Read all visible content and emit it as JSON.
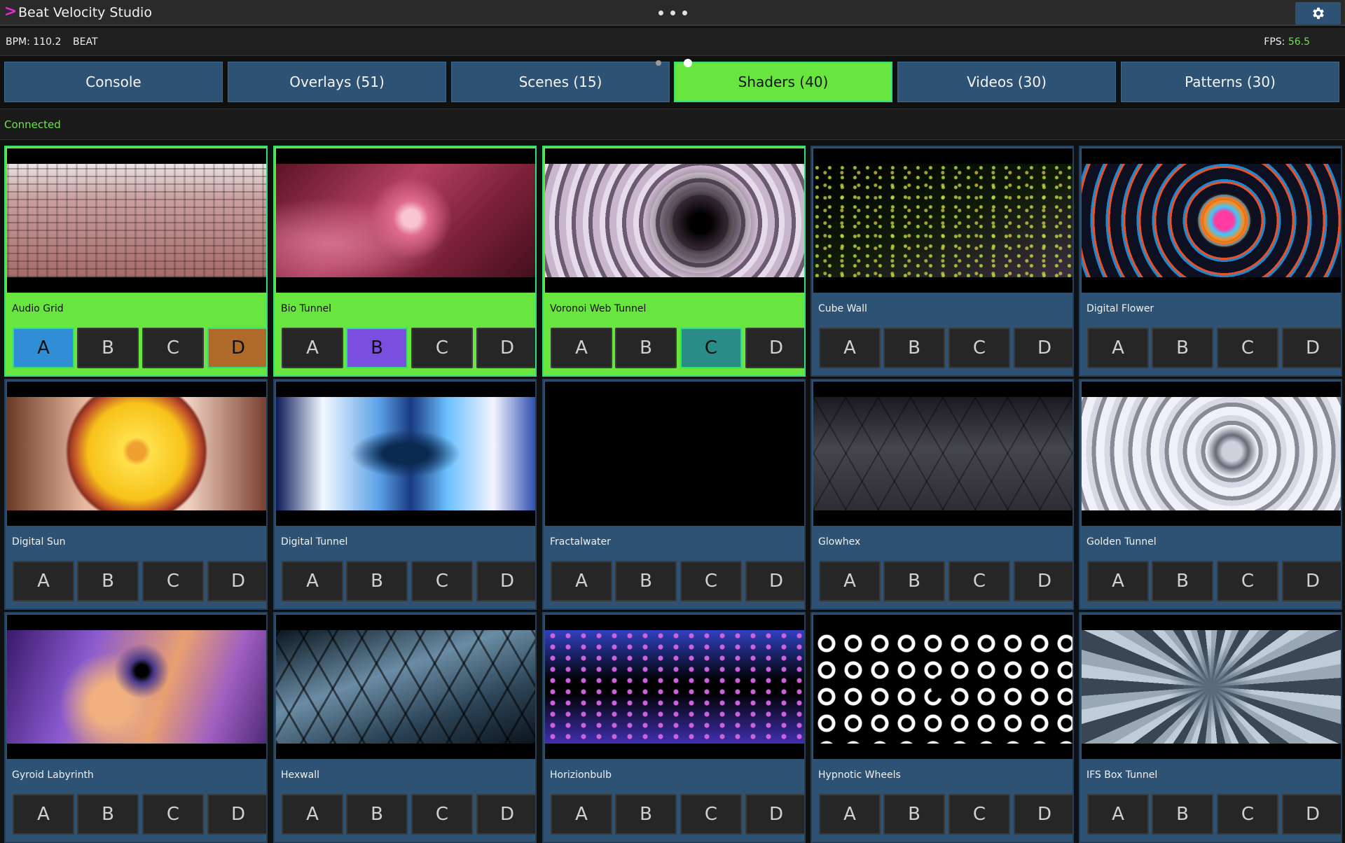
{
  "app": {
    "title": "Beat Velocity Studio",
    "more_icon": "more-dots-icon",
    "settings_icon": "gear-icon"
  },
  "status": {
    "bpm": "BPM: 110.2",
    "beat": "BEAT",
    "fps_label": "FPS: ",
    "fps_value": "56.5"
  },
  "tabs": [
    {
      "label": "Console",
      "active": false
    },
    {
      "label": "Overlays (51)",
      "active": false
    },
    {
      "label": "Scenes (15)",
      "active": false
    },
    {
      "label": "Shaders (40)",
      "active": true
    },
    {
      "label": "Videos (30)",
      "active": false
    },
    {
      "label": "Patterns (30)",
      "active": false
    }
  ],
  "connection": {
    "status": "Connected"
  },
  "colors": {
    "accent_green": "#68e53e",
    "card_blue": "#2e5273",
    "slot_a": "#2f8ed6",
    "slot_b": "#7a4fe0",
    "slot_c": "#2a8c86",
    "slot_d": "#b06a2a"
  },
  "slot_labels": [
    "A",
    "B",
    "C",
    "D"
  ],
  "shaders": [
    {
      "name": "Audio Grid",
      "active": true,
      "assigned": [
        "A",
        "D"
      ]
    },
    {
      "name": "Bio Tunnel",
      "active": true,
      "assigned": [
        "B"
      ]
    },
    {
      "name": "Voronoi Web Tunnel",
      "active": true,
      "assigned": [
        "C"
      ]
    },
    {
      "name": "Cube Wall",
      "active": false,
      "assigned": []
    },
    {
      "name": "Digital Flower",
      "active": false,
      "assigned": []
    },
    {
      "name": "Digital Sun",
      "active": false,
      "assigned": []
    },
    {
      "name": "Digital Tunnel",
      "active": false,
      "assigned": []
    },
    {
      "name": "Fractalwater",
      "active": false,
      "assigned": []
    },
    {
      "name": "Glowhex",
      "active": false,
      "assigned": []
    },
    {
      "name": "Golden Tunnel",
      "active": false,
      "assigned": []
    },
    {
      "name": "Gyroid Labyrinth",
      "active": false,
      "assigned": []
    },
    {
      "name": "Hexwall",
      "active": false,
      "assigned": []
    },
    {
      "name": "Horizionbulb",
      "active": false,
      "assigned": []
    },
    {
      "name": "Hypnotic Wheels",
      "active": false,
      "assigned": []
    },
    {
      "name": "IFS Box Tunnel",
      "active": false,
      "assigned": []
    }
  ]
}
